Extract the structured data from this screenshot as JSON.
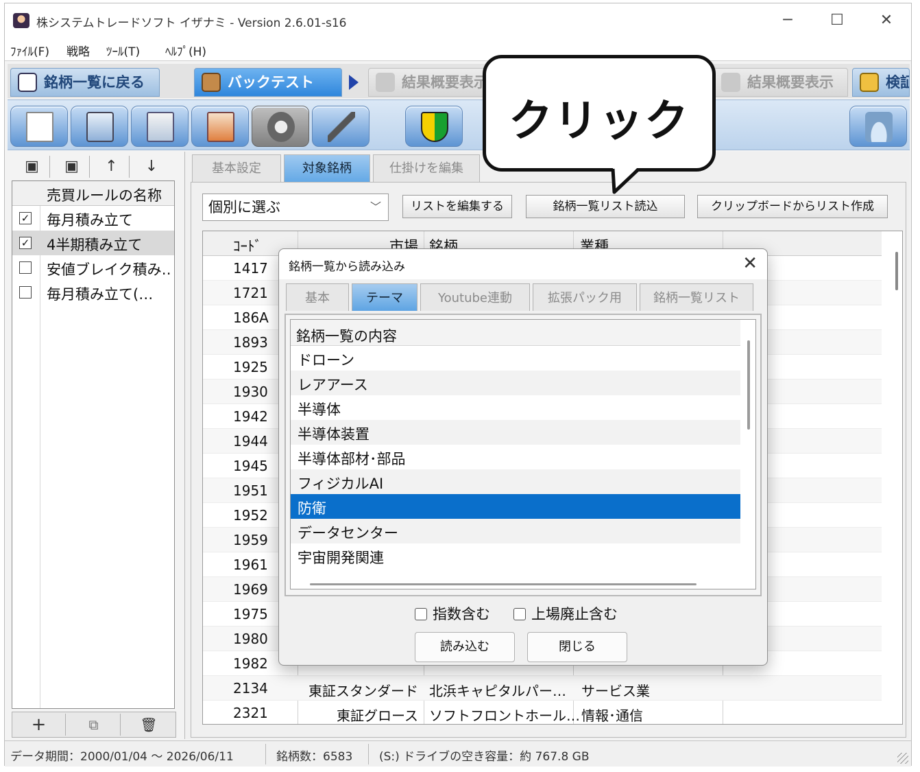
{
  "window": {
    "title": "株システムトレードソフト イザナミ - Version 2.6.01-s16",
    "controls": {
      "minimize": "─",
      "maximize": "☐",
      "close": "✕"
    }
  },
  "menu": [
    "ﾌｧｲﾙ(F)",
    "戦略",
    "ﾂｰﾙ(T)",
    "ﾍﾙﾌﾟ(H)"
  ],
  "main_tabs": [
    {
      "label": "銘柄一覧に戻る",
      "state": "normal"
    },
    {
      "label": "バックテスト",
      "state": "active"
    },
    {
      "label": "結果概要表示",
      "state": "dim"
    },
    {
      "label": "結果概要表示",
      "state": "dim"
    },
    {
      "label": "検証",
      "state": "normal"
    }
  ],
  "toolbar": {
    "icons": [
      "new-document-icon",
      "load-strategy-icon",
      "export-icon",
      "import-icon",
      "tools-icon",
      "wrench-icon",
      "beginner-mark-icon",
      "run-backtest-icon"
    ],
    "colors": {
      "button_top": "#c6dcf4",
      "button_bottom": "#5d94d3"
    }
  },
  "left_panel": {
    "toolbar_icons": [
      "save-icon",
      "save-as-icon",
      "arrow-up-icon",
      "arrow-down-icon"
    ],
    "header": "売買ルールの名称",
    "rules": [
      {
        "checked": true,
        "label": "毎月積み立て",
        "selected": false
      },
      {
        "checked": true,
        "label": "4半期積み立て",
        "selected": true
      },
      {
        "checked": false,
        "label": "安値ブレイク積み…",
        "selected": false
      },
      {
        "checked": false,
        "label": "毎月積み立て(…",
        "selected": false
      }
    ],
    "bottom_buttons": [
      "+",
      "⧉",
      "🗑"
    ]
  },
  "sub_tabs": [
    {
      "label": "基本設定",
      "active": false
    },
    {
      "label": "対象銘柄",
      "active": true
    },
    {
      "label": "仕掛けを編集",
      "active": false
    }
  ],
  "target_stocks": {
    "mode_select": "個別に選ぶ",
    "buttons": [
      "リストを編集する",
      "銘柄一覧リスト読込",
      "クリップボードからリスト作成"
    ],
    "columns": [
      "ｺｰﾄﾞ",
      "市場",
      "銘柄",
      "業種"
    ],
    "rows": [
      {
        "code": "1417",
        "market": "",
        "name": "",
        "sector": ""
      },
      {
        "code": "1721",
        "market": "",
        "name": "",
        "sector": ""
      },
      {
        "code": "186A",
        "market": "",
        "name": "",
        "sector": ""
      },
      {
        "code": "1893",
        "market": "",
        "name": "",
        "sector": ""
      },
      {
        "code": "1925",
        "market": "",
        "name": "",
        "sector": ""
      },
      {
        "code": "1930",
        "market": "",
        "name": "",
        "sector": ""
      },
      {
        "code": "1942",
        "market": "",
        "name": "",
        "sector": ""
      },
      {
        "code": "1944",
        "market": "",
        "name": "",
        "sector": ""
      },
      {
        "code": "1945",
        "market": "",
        "name": "",
        "sector": ""
      },
      {
        "code": "1951",
        "market": "",
        "name": "",
        "sector": ""
      },
      {
        "code": "1952",
        "market": "",
        "name": "",
        "sector": ""
      },
      {
        "code": "1959",
        "market": "",
        "name": "",
        "sector": ""
      },
      {
        "code": "1961",
        "market": "",
        "name": "",
        "sector": ""
      },
      {
        "code": "1969",
        "market": "",
        "name": "",
        "sector": ""
      },
      {
        "code": "1975",
        "market": "",
        "name": "",
        "sector": ""
      },
      {
        "code": "1980",
        "market": "",
        "name": "",
        "sector": ""
      },
      {
        "code": "1982",
        "market": "",
        "name": "",
        "sector": ""
      },
      {
        "code": "2134",
        "market": "東証スタンダード",
        "name": "北浜キャピタルパー…",
        "sector": "サービス業"
      },
      {
        "code": "2321",
        "market": "東証グロース",
        "name": "ソフトフロントホール…",
        "sector": "情報･通信"
      }
    ]
  },
  "dialog": {
    "title": "銘柄一覧から読み込み",
    "close": "✕",
    "tabs": [
      {
        "label": "基本",
        "active": false
      },
      {
        "label": "テーマ",
        "active": true
      },
      {
        "label": "Youtube連動",
        "active": false
      },
      {
        "label": "拡張パック用",
        "active": false
      },
      {
        "label": "銘柄一覧リスト",
        "active": false
      }
    ],
    "list_header": "銘柄一覧の内容",
    "themes": [
      {
        "label": "ドローン",
        "selected": false
      },
      {
        "label": "レアアース",
        "selected": false
      },
      {
        "label": "半導体",
        "selected": false
      },
      {
        "label": "半導体装置",
        "selected": false
      },
      {
        "label": "半導体部材･部品",
        "selected": false
      },
      {
        "label": "フィジカルAI",
        "selected": false
      },
      {
        "label": "防衛",
        "selected": true
      },
      {
        "label": "データセンター",
        "selected": false
      },
      {
        "label": "宇宙開発関連",
        "selected": false
      }
    ],
    "checkboxes": [
      {
        "label": "指数含む",
        "checked": false
      },
      {
        "label": "上場廃止含む",
        "checked": false
      }
    ],
    "buttons": {
      "load": "読み込む",
      "close": "閉じる"
    },
    "colors": {
      "selected_row": "#0a6fcb"
    }
  },
  "status": {
    "period": "データ期間：2000/01/04 ～ 2026/06/11",
    "count": "銘柄数：6583",
    "disk": "(S:) ドライブの空き容量：約 767.8 GB"
  },
  "callout": {
    "text": "クリック"
  }
}
